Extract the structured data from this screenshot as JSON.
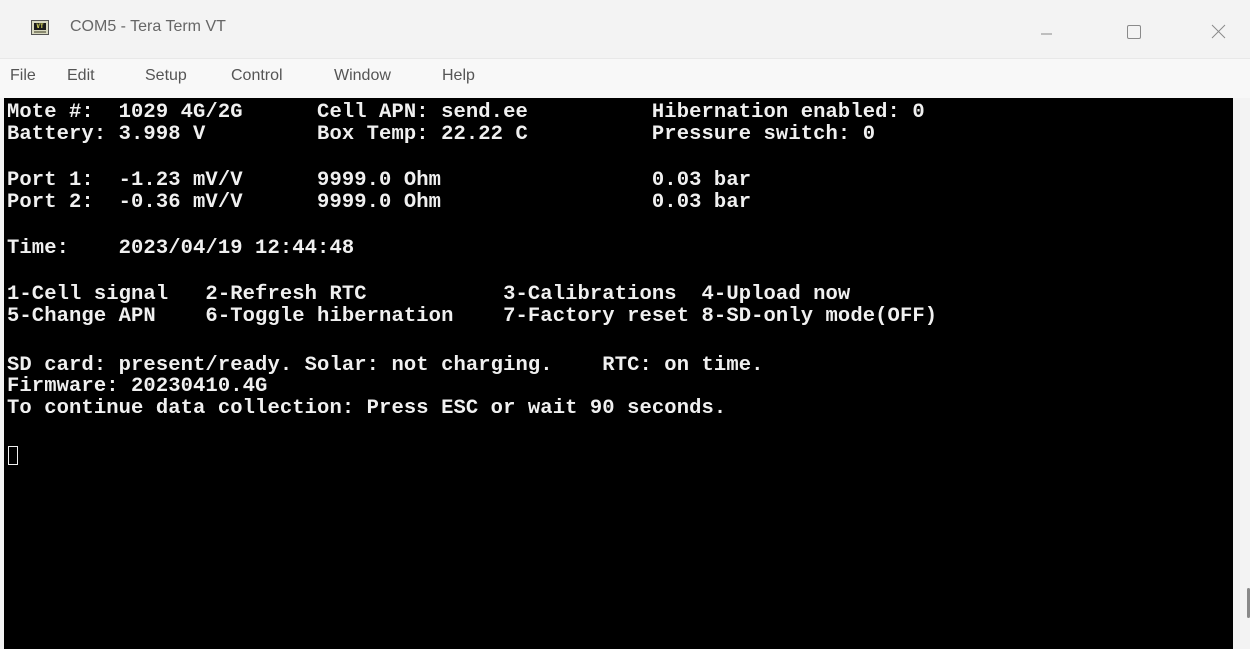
{
  "window": {
    "title": "COM5 - Tera Term VT",
    "icon": "tera-term-vt-icon",
    "icon_label": "VT"
  },
  "menu": [
    {
      "label": "File"
    },
    {
      "label": "Edit"
    },
    {
      "label": "Setup"
    },
    {
      "label": "Control"
    },
    {
      "label": "Window"
    },
    {
      "label": "Help"
    }
  ],
  "controls": {
    "minimize_icon": "minimize-icon",
    "maximize_icon": "maximize-icon",
    "close_icon": "close-icon"
  },
  "terminal": {
    "lines": [
      "Mote #:  1029 4G/2G      Cell APN: send.ee          Hibernation enabled: 0",
      "Battery: 3.998 V         Box Temp: 22.22 C          Pressure switch: 0",
      "",
      "Port 1:  -1.23 mV/V      9999.0 Ohm                 0.03 bar",
      "Port 2:  -0.36 mV/V      9999.0 Ohm                 0.03 bar",
      "",
      "Time:    2023/04/19 12:44:48",
      "",
      "1-Cell signal   2-Refresh RTC           3-Calibrations  4-Upload now",
      "5-Change APN    6-Toggle hibernation    7-Factory reset 8-SD-only mode(OFF)",
      "",
      "SD card: present/ready. Solar: not charging.    RTC: on time.",
      "Firmware: 20230410.4G",
      "To continue data collection: Press ESC or wait 90 seconds."
    ]
  },
  "colors": {
    "terminal_bg": "#000000",
    "terminal_fg": "#f0f0f0",
    "chrome_bg": "#f3f3f3"
  }
}
